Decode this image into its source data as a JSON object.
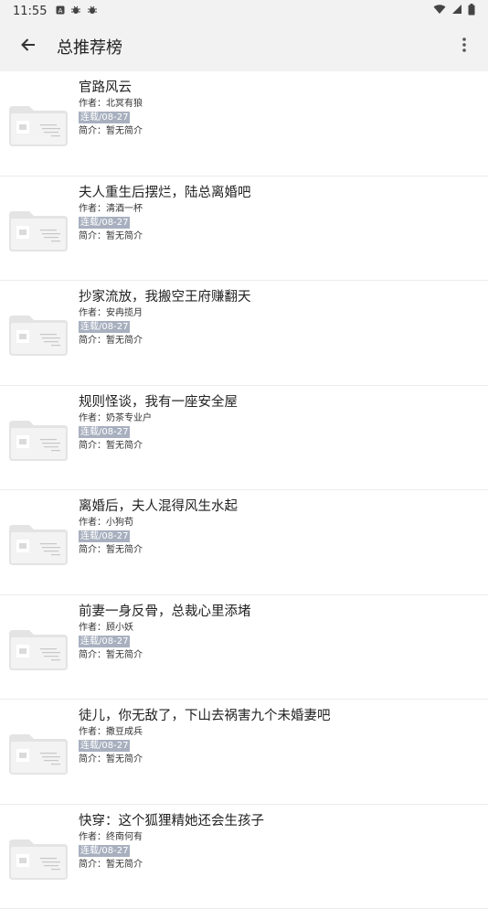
{
  "status_bar": {
    "time": "11:55",
    "icons": [
      "notification-a-icon",
      "bug-icon",
      "bug-icon"
    ],
    "right_icons": [
      "wifi-icon",
      "signal-icon",
      "battery-icon"
    ]
  },
  "app_bar": {
    "title": "总推荐榜",
    "back_icon": "arrow-left-icon",
    "more_icon": "more-vert-icon"
  },
  "labels": {
    "author_prefix": "作者：",
    "intro_prefix": "简介："
  },
  "books": [
    {
      "title": "官路风云",
      "author": "北冥有狼",
      "status": "连载/08-27",
      "intro": "暂无简介"
    },
    {
      "title": "夫人重生后摆烂，陆总离婚吧",
      "author": "清酒一杯",
      "status": "连载/08-27",
      "intro": "暂无简介"
    },
    {
      "title": "抄家流放，我搬空王府赚翻天",
      "author": "安冉揽月",
      "status": "连载/08-27",
      "intro": "暂无简介"
    },
    {
      "title": "规则怪谈，我有一座安全屋",
      "author": "奶茶专业户",
      "status": "连载/08-27",
      "intro": "暂无简介"
    },
    {
      "title": "离婚后，夫人混得风生水起",
      "author": "小狗苟",
      "status": "连载/08-27",
      "intro": "暂无简介"
    },
    {
      "title": "前妻一身反骨，总裁心里添堵",
      "author": "顾小妖",
      "status": "连载/08-27",
      "intro": "暂无简介"
    },
    {
      "title": "徒儿，你无敌了，下山去祸害九个未婚妻吧",
      "author": "撒豆成兵",
      "status": "连载/08-27",
      "intro": "暂无简介"
    },
    {
      "title": "快穿：这个狐狸精她还会生孩子",
      "author": "终南何有",
      "status": "连载/08-27",
      "intro": "暂无简介"
    }
  ]
}
